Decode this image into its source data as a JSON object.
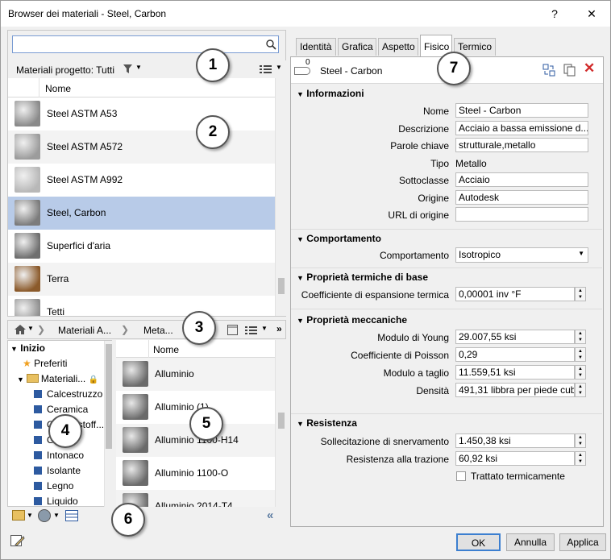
{
  "window": {
    "title": "Browser dei materiali - Steel, Carbon",
    "help": "?",
    "close": "✕"
  },
  "search": {
    "placeholder": ""
  },
  "project_header": {
    "label": "Materiali progetto: Tutti"
  },
  "list_header": {
    "name_col": "Nome"
  },
  "project_materials": [
    {
      "name": "Steel ASTM A53",
      "color": "#8a8a8a"
    },
    {
      "name": "Steel ASTM A572",
      "color": "#9c9c9c"
    },
    {
      "name": "Steel ASTM A992",
      "color": "#b8b8b8"
    },
    {
      "name": "Steel, Carbon",
      "color": "#7c7c7c"
    },
    {
      "name": "Superfici d'aria",
      "color": "#6f6f6f"
    },
    {
      "name": "Terra",
      "color": "#8b5a2b"
    },
    {
      "name": "Tetti",
      "color": "#8f8f8f"
    }
  ],
  "breadcrumb": {
    "items": [
      "Materiali A...",
      "Meta..."
    ]
  },
  "tree": {
    "root": "Inizio",
    "favorites": "Preferiti",
    "library": "Materiali...",
    "children": [
      "Calcestruzzo",
      "Ceramica",
      "Combustoff...",
      "Gas",
      "Intonaco",
      "Isolante",
      "Legno",
      "Liquido"
    ]
  },
  "lib_header": {
    "name_col": "Nome"
  },
  "library_materials": [
    "Alluminio",
    "Alluminio (1)",
    "Alluminio 1100-H14",
    "Alluminio 1100-O",
    "Alluminio 2014-T4"
  ],
  "tabs": [
    "Identità",
    "Grafica",
    "Aspetto",
    "Fisico",
    "Termico"
  ],
  "asset": {
    "count": "0",
    "name": "Steel - Carbon"
  },
  "info": {
    "title": "Informazioni",
    "rows": [
      {
        "label": "Nome",
        "value": "Steel - Carbon"
      },
      {
        "label": "Descrizione",
        "value": "Acciaio a bassa emissione d..."
      },
      {
        "label": "Parole chiave",
        "value": "strutturale,metallo"
      },
      {
        "label": "Tipo",
        "value": "Metallo"
      },
      {
        "label": "Sottoclasse",
        "value": "Acciaio"
      },
      {
        "label": "Origine",
        "value": "Autodesk"
      },
      {
        "label": "URL di origine",
        "value": ""
      }
    ]
  },
  "behavior": {
    "title": "Comportamento",
    "label": "Comportamento",
    "value": "Isotropico"
  },
  "thermal": {
    "title": "Proprietà termiche di base",
    "label": "Coefficiente di espansione termica",
    "value": "0,00001 inv °F"
  },
  "mechanical": {
    "title": "Proprietà meccaniche",
    "rows": [
      {
        "label": "Modulo di Young",
        "value": "29.007,55 ksi"
      },
      {
        "label": "Coefficiente di Poisson",
        "value": "0,29"
      },
      {
        "label": "Modulo a taglio",
        "value": "11.559,51 ksi"
      },
      {
        "label": "Densità",
        "value": "491,31 libbra per piede cubico"
      }
    ]
  },
  "strength": {
    "title": "Resistenza",
    "rows": [
      {
        "label": "Sollecitazione di snervamento",
        "value": "1.450,38 ksi"
      },
      {
        "label": "Resistenza alla trazione",
        "value": "60,92 ksi"
      }
    ],
    "heat_treated": "Trattato termicamente"
  },
  "buttons": {
    "ok": "OK",
    "cancel": "Annulla",
    "apply": "Applica"
  },
  "badges": [
    "1",
    "2",
    "3",
    "4",
    "5",
    "6",
    "7"
  ],
  "colors": {
    "selection": "#b8cbe8",
    "badge_border": "#555555",
    "delete": "#d12a2a"
  }
}
